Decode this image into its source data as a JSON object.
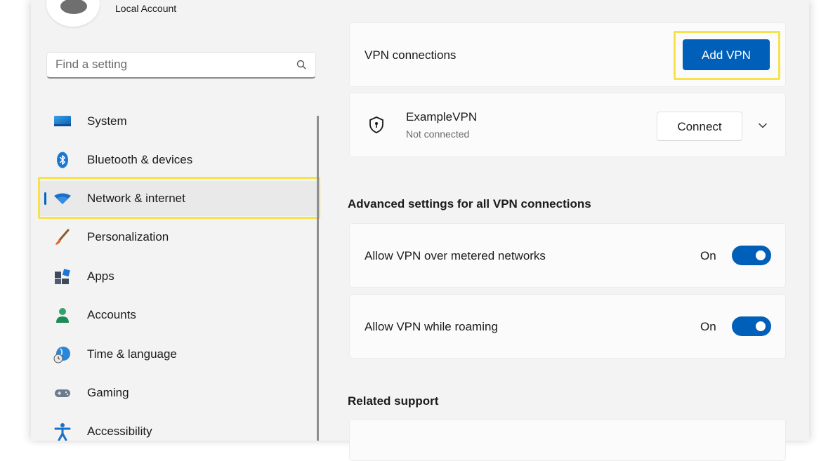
{
  "account": {
    "type": "Local Account"
  },
  "search": {
    "placeholder": "Find a setting",
    "value": ""
  },
  "sidebar": {
    "items": [
      {
        "label": "System",
        "icon": "system-icon"
      },
      {
        "label": "Bluetooth & devices",
        "icon": "bluetooth-icon"
      },
      {
        "label": "Network & internet",
        "icon": "wifi-icon",
        "selected": true
      },
      {
        "label": "Personalization",
        "icon": "brush-icon"
      },
      {
        "label": "Apps",
        "icon": "apps-icon"
      },
      {
        "label": "Accounts",
        "icon": "person-icon"
      },
      {
        "label": "Time & language",
        "icon": "globe-clock-icon"
      },
      {
        "label": "Gaming",
        "icon": "gamepad-icon"
      },
      {
        "label": "Accessibility",
        "icon": "accessibility-icon"
      }
    ]
  },
  "main": {
    "vpn_connections": {
      "label": "VPN connections",
      "add_button": "Add VPN"
    },
    "vpn_item": {
      "name": "ExampleVPN",
      "status": "Not connected",
      "connect_button": "Connect"
    },
    "advanced": {
      "heading": "Advanced settings for all VPN connections",
      "settings": [
        {
          "label": "Allow VPN over metered networks",
          "state": "On",
          "on": true
        },
        {
          "label": "Allow VPN while roaming",
          "state": "On",
          "on": true
        }
      ]
    },
    "related_support": {
      "heading": "Related support"
    }
  },
  "colors": {
    "accent": "#005fb8",
    "highlight": "#f7e24b",
    "window_bg": "#f3f3f3"
  }
}
